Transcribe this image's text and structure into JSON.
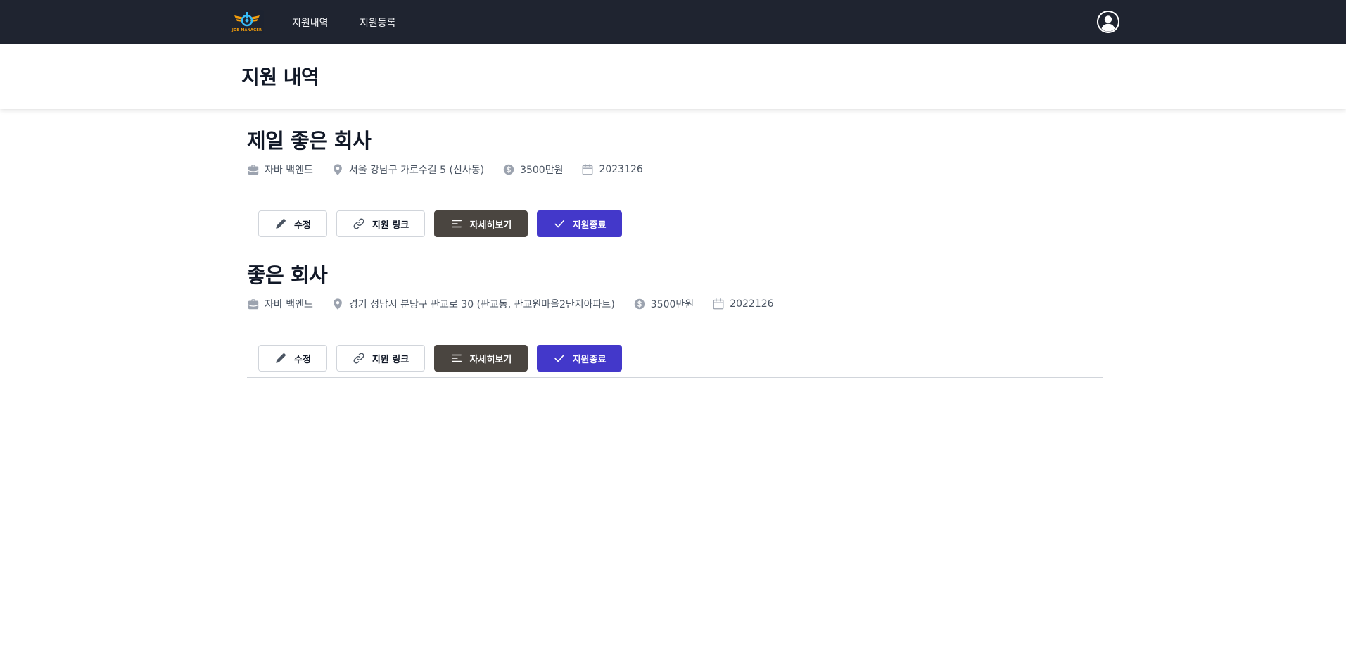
{
  "nav": {
    "logo_text": "JOB MANAGER",
    "links": [
      "지원내역",
      "지원등록"
    ]
  },
  "page": {
    "title": "지원 내역"
  },
  "applications": [
    {
      "company": "제일 좋은 회사",
      "position": "자바 백엔드",
      "address": "서울 강남구 가로수길 5 (신사동)",
      "salary": "3500만원",
      "date": "2023126"
    },
    {
      "company": "좋은 회사",
      "position": "자바 백엔드",
      "address": "경기 성남시 분당구 판교로 30 (판교동, 판교원마을2단지아파트)",
      "salary": "3500만원",
      "date": "2022126"
    }
  ],
  "buttons": {
    "edit": "수정",
    "link": "지원 링크",
    "detail": "자세히보기",
    "done": "지원종료"
  },
  "colors": {
    "navbar": "#1f2430",
    "detail_button": "#4a4540",
    "done_button": "#4338ca"
  }
}
